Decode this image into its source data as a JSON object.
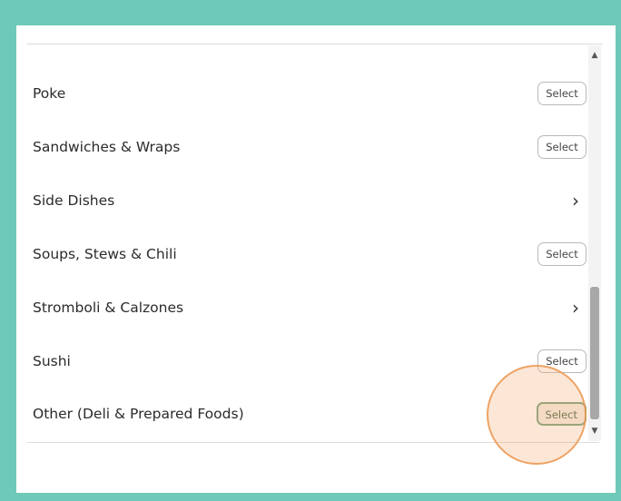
{
  "list": {
    "items": [
      {
        "label": "Poke",
        "action": "select",
        "action_label": "Select"
      },
      {
        "label": "Sandwiches & Wraps",
        "action": "select",
        "action_label": "Select"
      },
      {
        "label": "Side Dishes",
        "action": "chevron",
        "action_label": ""
      },
      {
        "label": "Soups, Stews & Chili",
        "action": "select",
        "action_label": "Select"
      },
      {
        "label": "Stromboli & Calzones",
        "action": "chevron",
        "action_label": ""
      },
      {
        "label": "Sushi",
        "action": "select",
        "action_label": "Select"
      },
      {
        "label": "Other (Deli & Prepared Foods)",
        "action": "select",
        "action_label": "Select",
        "highlighted": true
      }
    ]
  },
  "icons": {
    "chevron": "chevron-right-icon",
    "scroll_up": "arrow-up-icon",
    "scroll_down": "arrow-down-icon"
  },
  "colors": {
    "background": "#6ec9b9",
    "highlight": "#f5aa6e",
    "selected_button_border": "#7aa37e"
  }
}
